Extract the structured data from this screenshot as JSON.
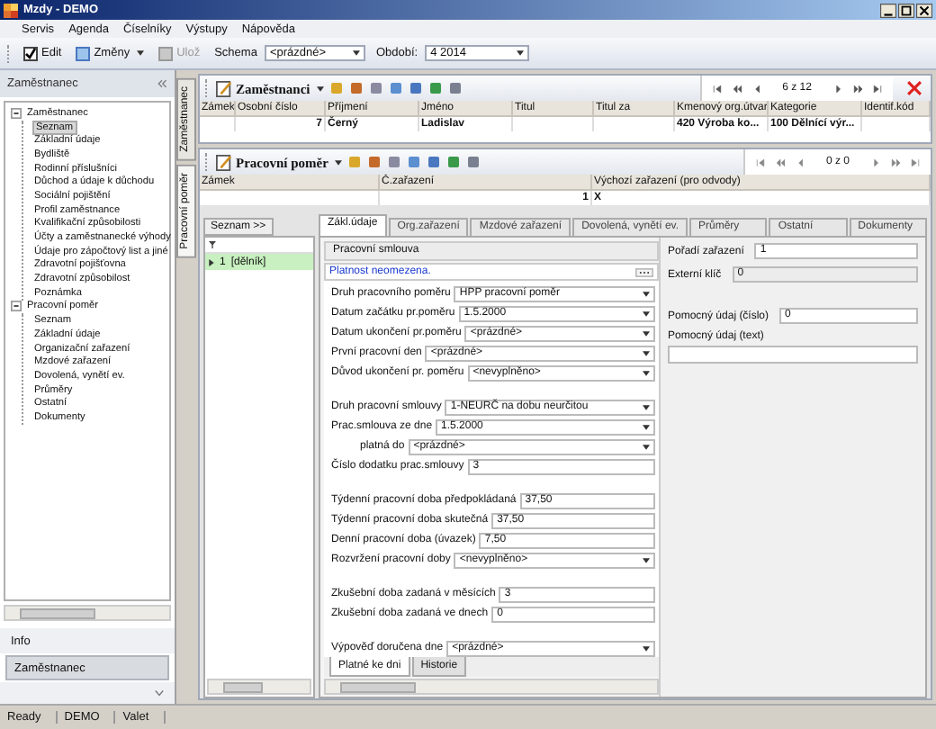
{
  "window": {
    "title": "Mzdy - DEMO"
  },
  "menu": [
    "Servis",
    "Agenda",
    "Číselníky",
    "Výstupy",
    "Nápověda"
  ],
  "toolbar": {
    "edit": {
      "label": "Edit",
      "checked": true
    },
    "changes": "Změny",
    "save": {
      "label": "Ulož",
      "disabled": true
    },
    "schema_label": "Schema",
    "schema_value": "<prázdné>",
    "period_label": "Období:",
    "period_value": "4  2014"
  },
  "sidebar": {
    "title": "Zaměstnanec",
    "tree": [
      {
        "label": "Zaměstnanec",
        "expanded": true,
        "selected": false,
        "children": [
          {
            "label": "Seznam",
            "selected": true
          },
          {
            "label": "Základní údaje",
            "selected": false
          },
          {
            "label": "Bydliště",
            "selected": false
          },
          {
            "label": "Rodinní příslušníci",
            "selected": false
          },
          {
            "label": "Důchod a údaje k důchodu",
            "selected": false
          },
          {
            "label": "Sociální pojištění",
            "selected": false
          },
          {
            "label": "Profil zaměstnance",
            "selected": false
          },
          {
            "label": "Kvalifikační způsobilosti",
            "selected": false
          },
          {
            "label": "Účty a zaměstnanecké výhody",
            "selected": false
          },
          {
            "label": "Údaje pro zápočtový list a jiné",
            "selected": false
          },
          {
            "label": "Zdravotní pojišťovna",
            "selected": false
          },
          {
            "label": "Zdravotní způsobilost",
            "selected": false
          },
          {
            "label": "Poznámka",
            "selected": false
          }
        ]
      },
      {
        "label": "Pracovní poměr",
        "expanded": true,
        "selected": false,
        "children": [
          {
            "label": "Seznam",
            "selected": false
          },
          {
            "label": "Základní údaje",
            "selected": false
          },
          {
            "label": "Organizační zařazení",
            "selected": false
          },
          {
            "label": "Mzdové zařazení",
            "selected": false
          },
          {
            "label": "Dovolená, vynětí ev.",
            "selected": false
          },
          {
            "label": "Průměry",
            "selected": false
          },
          {
            "label": "Ostatní",
            "selected": false
          },
          {
            "label": "Dokumenty",
            "selected": false
          }
        ]
      }
    ],
    "info": "Info",
    "section_button": "Zaměstnanec"
  },
  "vertical_tabs": [
    {
      "label": "Zaměstnanec",
      "selected": false
    },
    {
      "label": "Pracovní poměr",
      "selected": true
    }
  ],
  "employees": {
    "title": "Zaměstnanci",
    "pager": "6 z 12",
    "columns": [
      "Zámek",
      "Osobní číslo",
      "Příjmení",
      "Jméno",
      "Titul",
      "Titul za",
      "Kmenový org.útvar",
      "Kategorie",
      "Identif.kód"
    ],
    "rows": [
      [
        "",
        "7",
        "Černý",
        "Ladislav",
        "",
        "",
        "420  Výroba ko...",
        "100  Dělnící výr...",
        ""
      ]
    ]
  },
  "employment": {
    "title": "Pracovní poměr",
    "pager": "0 z 0",
    "columns": [
      "Zámek",
      "Č.zařazení",
      "Výchozí zařazení (pro odvody)"
    ],
    "rows": [
      [
        "",
        "1",
        "X"
      ]
    ],
    "list_button": "Seznam >>",
    "list_items": [
      {
        "number": "1",
        "label": "[dělník]",
        "selected": true
      }
    ],
    "tabs": [
      {
        "label": "Zákl.údaje",
        "selected": true
      },
      {
        "label": "Org.zařazení",
        "selected": false
      },
      {
        "label": "Mzdové zařazení",
        "selected": false
      },
      {
        "label": "Dovolená, vynětí ev.",
        "selected": false
      },
      {
        "label": "Průměry",
        "selected": false
      },
      {
        "label": "Ostatní",
        "selected": false
      },
      {
        "label": "Dokumenty",
        "selected": false
      }
    ],
    "group_title": "Pracovní smlouva",
    "notice": "Platnost neomezena.",
    "field_groups": [
      [
        {
          "label": "Druh pracovního poměru",
          "value": "HPP  pracovní poměr",
          "kind": "select",
          "indented": false
        },
        {
          "label": "Datum začátku pr.poměru",
          "value": "1.5.2000",
          "kind": "select",
          "indented": false
        },
        {
          "label": "Datum ukončení pr.poměru",
          "value": "<prázdné>",
          "kind": "select",
          "indented": false
        },
        {
          "label": "První pracovní den",
          "value": "<prázdné>",
          "kind": "select",
          "indented": false
        },
        {
          "label": "Důvod ukončení pr. poměru",
          "value": "<nevyplněno>",
          "kind": "select",
          "indented": false
        }
      ],
      [
        {
          "label": "Druh pracovní smlouvy",
          "value": "1-NEURČ   na dobu neurčitou",
          "kind": "select",
          "indented": false
        },
        {
          "label": "Prac.smlouva ze dne",
          "value": "1.5.2000",
          "kind": "select",
          "indented": false
        },
        {
          "label": "platná do",
          "value": "<prázdné>",
          "kind": "select",
          "indented": true
        },
        {
          "label": "Číslo dodatku prac.smlouvy",
          "value": "3",
          "kind": "text",
          "indented": false
        }
      ],
      [
        {
          "label": "Týdenní pracovní doba předpokládaná",
          "value": "37,50",
          "kind": "text",
          "indented": false
        },
        {
          "label": "Týdenní pracovní doba skutečná",
          "value": "37,50",
          "kind": "text",
          "indented": false
        },
        {
          "label": "Denní pracovní doba (úvazek)",
          "value": "7,50",
          "kind": "text",
          "indented": false
        },
        {
          "label": "Rozvržení pracovní doby",
          "value": "<nevyplněno>",
          "kind": "select",
          "indented": false
        }
      ],
      [
        {
          "label": "Zkušební doba zadaná v měsících",
          "value": "3",
          "kind": "text",
          "indented": false
        },
        {
          "label": "Zkušební doba zadaná ve dnech",
          "value": "0",
          "kind": "text",
          "indented": false
        }
      ],
      [
        {
          "label": "Výpověď doručena dne",
          "value": "<prázdné>",
          "kind": "select",
          "indented": false
        }
      ]
    ],
    "side_fields": [
      {
        "label": "Pořadí zařazení",
        "value": "1",
        "kind": "inline",
        "disabled": false
      },
      {
        "label": "Externí klíč",
        "value": "0",
        "kind": "inline",
        "disabled": true
      },
      {
        "label": "Pomocný údaj (číslo)",
        "value": "0",
        "kind": "inline",
        "disabled": false
      },
      {
        "label": "Pomocný údaj (text)",
        "kind": "stacked",
        "disabled": false
      }
    ],
    "bottom_tabs": [
      {
        "label": "Platné ke dni",
        "selected": true
      },
      {
        "label": "Historie",
        "selected": false
      }
    ]
  },
  "status_bar": [
    "Ready",
    "DEMO",
    "Valet"
  ]
}
